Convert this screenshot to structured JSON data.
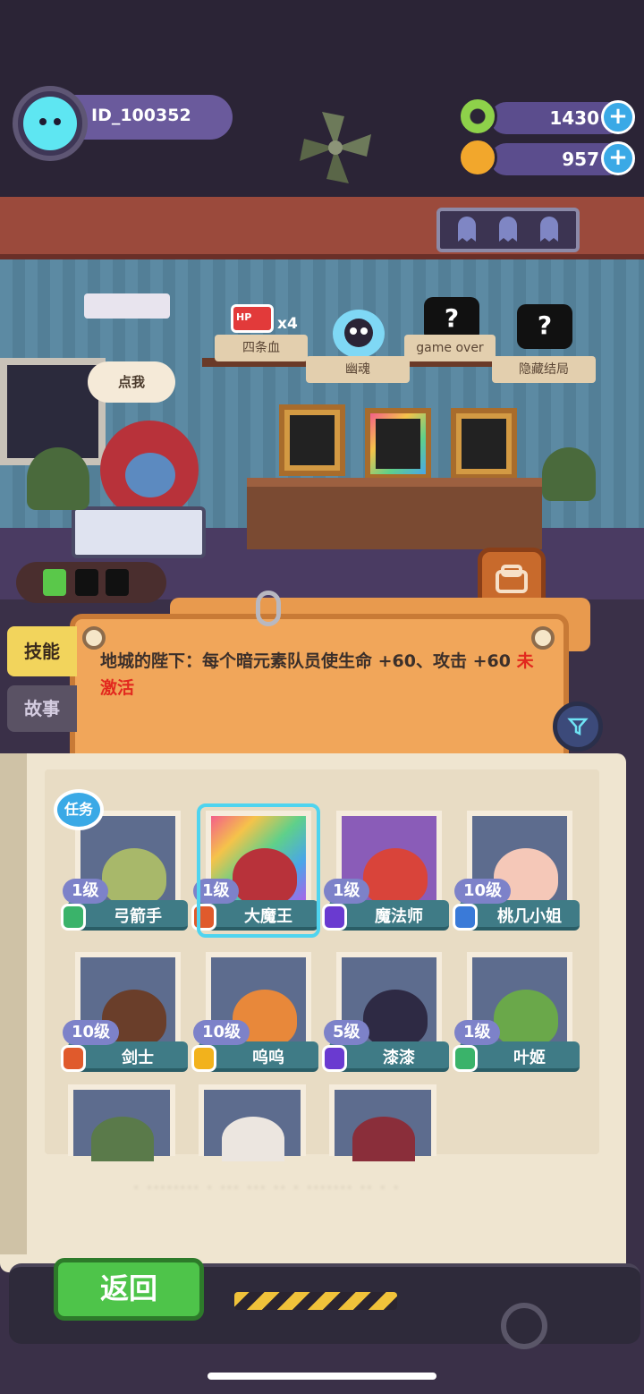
{
  "player": {
    "id": "ID_100352"
  },
  "currency": {
    "gems": {
      "value": "1430",
      "icon": "green-donut-icon"
    },
    "coins": {
      "value": "957",
      "icon": "orange-planet-icon"
    },
    "plus": "+"
  },
  "endings": [
    {
      "label": "四条血",
      "icon": "hp-battery-icon",
      "badge": "x4"
    },
    {
      "label": "幽魂",
      "icon": "ghost-skull-icon"
    },
    {
      "label": "game over",
      "icon": "locked-mystery-icon"
    },
    {
      "label": "隐藏结局",
      "icon": "locked-mystery-icon"
    }
  ],
  "hp_tag": "HP",
  "mystery_mark": "?",
  "speech_bubble": "点我",
  "side_tabs": {
    "skill": "技能",
    "story": "故事"
  },
  "skill": {
    "description": "地城的陛下：每个暗元素队员使生命 +60、攻击 +60",
    "status": "未激活"
  },
  "task_badge": "任务",
  "heroes": [
    {
      "name": "弓箭手",
      "level": "1级",
      "element": "green"
    },
    {
      "name": "大魔王",
      "level": "1级",
      "element": "red",
      "selected": true
    },
    {
      "name": "魔法师",
      "level": "1级",
      "element": "purple"
    },
    {
      "name": "桃几小姐",
      "level": "10级",
      "element": "blue"
    },
    {
      "name": "剑士",
      "level": "10级",
      "element": "red"
    },
    {
      "name": "呜呜",
      "level": "10级",
      "element": "yellow"
    },
    {
      "name": "漆漆",
      "level": "5级",
      "element": "purple"
    },
    {
      "name": "叶姬",
      "level": "1级",
      "element": "green"
    }
  ],
  "footer_blurred": "· ········ · ···    ··· ·· · ······· ·· · ·",
  "back_button": "返回",
  "colors": {
    "accent_green": "#4ec44a",
    "skill_board": "#f1a65a",
    "inactive_red": "#e2281e",
    "tab_active": "#f2d45c"
  }
}
